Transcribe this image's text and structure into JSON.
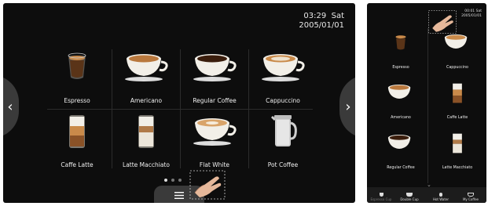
{
  "screen_a": {
    "clock": {
      "time": "03:29",
      "day": "Sat",
      "date": "2005/01/01"
    },
    "nav": {
      "left_icon": "chevron-left-icon",
      "left_glyph": "‹",
      "right_icon": "chevron-right-icon",
      "right_glyph": "›"
    },
    "beverages": [
      {
        "label": "Espresso",
        "icon": "espresso-cup-icon"
      },
      {
        "label": "Americano",
        "icon": "americano-cup-icon"
      },
      {
        "label": "Regular Coffee",
        "icon": "regular-coffee-cup-icon"
      },
      {
        "label": "Cappuccino",
        "icon": "cappuccino-cup-icon"
      },
      {
        "label": "Caffe Latte",
        "icon": "caffe-latte-glass-icon"
      },
      {
        "label": "Latte Macchiato",
        "icon": "latte-macchiato-glass-icon"
      },
      {
        "label": "Flat White",
        "icon": "flat-white-cup-icon"
      },
      {
        "label": "Pot Coffee",
        "icon": "coffee-pot-icon"
      }
    ],
    "page_dots": {
      "count": 3,
      "active_index": 0
    },
    "menu_tab_icon": "menu-icon"
  },
  "screen_b": {
    "clock": {
      "time": "00:01",
      "day": "Sat",
      "date": "2005/01/01"
    },
    "beverages": [
      {
        "label": "Espresso",
        "icon": "espresso-cup-icon"
      },
      {
        "label": "Cappuccino",
        "icon": "cappuccino-cup-icon"
      },
      {
        "label": "Americano",
        "icon": "americano-cup-icon"
      },
      {
        "label": "Caffe Latte",
        "icon": "caffe-latte-glass-icon"
      },
      {
        "label": "Regular Coffee",
        "icon": "regular-coffee-cup-icon"
      },
      {
        "label": "Latte Macchiato",
        "icon": "latte-macchiato-glass-icon"
      }
    ],
    "scroll_icon": "chevron-down-icon",
    "toolbar": [
      {
        "label": "Espresso Cup",
        "icon": "espresso-cup-icon"
      },
      {
        "label": "Double Cup",
        "icon": "double-cup-icon"
      },
      {
        "label": "Hot Water",
        "icon": "hot-water-icon"
      },
      {
        "label": "My Coffee",
        "icon": "my-coffee-icon"
      }
    ]
  },
  "colors": {
    "screen_bg": "#0d0d0d",
    "panel": "#3a3a3a",
    "text": "#f0f0f0",
    "coffee": "#5a3418",
    "crema": "#c98a4a",
    "milk": "#f2efe8"
  }
}
